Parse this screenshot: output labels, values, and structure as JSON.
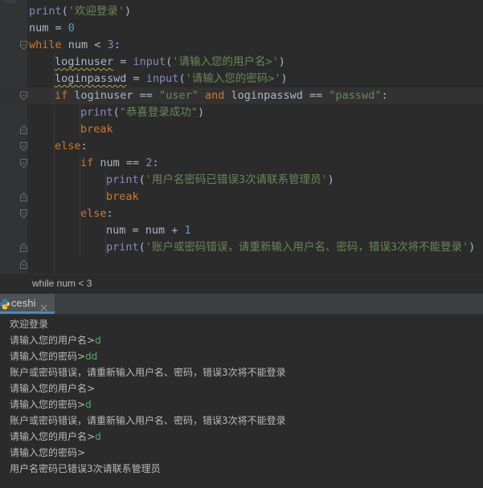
{
  "editor": {
    "lines": [
      [
        {
          "t": "print",
          "c": "fn"
        },
        {
          "t": "(",
          "c": "op"
        },
        {
          "t": "'欢迎登录'",
          "c": "str"
        },
        {
          "t": ")",
          "c": "op"
        }
      ],
      [
        {
          "t": "num",
          "c": "var"
        },
        {
          "t": " = ",
          "c": "op"
        },
        {
          "t": "0",
          "c": "num"
        }
      ],
      [
        {
          "t": "while",
          "c": "kw"
        },
        {
          "t": " num < ",
          "c": "op"
        },
        {
          "t": "3",
          "c": "num"
        },
        {
          "t": ":",
          "c": "op"
        }
      ],
      [
        {
          "t": "loginuser",
          "c": "var warn"
        },
        {
          "t": " = ",
          "c": "op"
        },
        {
          "t": "input",
          "c": "fn"
        },
        {
          "t": "(",
          "c": "op"
        },
        {
          "t": "'请输入您的用户名>'",
          "c": "str"
        },
        {
          "t": ")",
          "c": "op"
        }
      ],
      [
        {
          "t": "loginpasswd",
          "c": "var warn"
        },
        {
          "t": " = ",
          "c": "op"
        },
        {
          "t": "input",
          "c": "fn"
        },
        {
          "t": "(",
          "c": "op"
        },
        {
          "t": "'请输入您的密码>'",
          "c": "str"
        },
        {
          "t": ")",
          "c": "op"
        }
      ],
      [
        {
          "t": "if",
          "c": "kw"
        },
        {
          "t": " loginuser == ",
          "c": "op"
        },
        {
          "t": "\"user\"",
          "c": "str"
        },
        {
          "t": " ",
          "c": "op"
        },
        {
          "t": "and",
          "c": "kw"
        },
        {
          "t": " loginpasswd == ",
          "c": "op"
        },
        {
          "t": "\"passwd\"",
          "c": "str"
        },
        {
          "t": ":",
          "c": "op"
        }
      ],
      [
        {
          "t": "print",
          "c": "fn"
        },
        {
          "t": "(",
          "c": "op"
        },
        {
          "t": "\"恭喜登录成功\"",
          "c": "str"
        },
        {
          "t": ")",
          "c": "op"
        }
      ],
      [
        {
          "t": "break",
          "c": "kw"
        }
      ],
      [
        {
          "t": "else",
          "c": "kw"
        },
        {
          "t": ":",
          "c": "op"
        }
      ],
      [
        {
          "t": "if",
          "c": "kw"
        },
        {
          "t": " num == ",
          "c": "op"
        },
        {
          "t": "2",
          "c": "num"
        },
        {
          "t": ":",
          "c": "op"
        }
      ],
      [
        {
          "t": "print",
          "c": "fn"
        },
        {
          "t": "(",
          "c": "op"
        },
        {
          "t": "'用户名密码已错误3次请联系管理员'",
          "c": "str"
        },
        {
          "t": ")",
          "c": "op"
        }
      ],
      [
        {
          "t": "break",
          "c": "kw"
        }
      ],
      [
        {
          "t": "else",
          "c": "kw"
        },
        {
          "t": ":",
          "c": "op"
        }
      ],
      [
        {
          "t": "num = num + ",
          "c": "op"
        },
        {
          "t": "1",
          "c": "num"
        }
      ],
      [
        {
          "t": "print",
          "c": "fn"
        },
        {
          "t": "(",
          "c": "op"
        },
        {
          "t": "'账户或密码错误，请重新输入用户名、密码，错误3次将不能登录'",
          "c": "str"
        },
        {
          "t": ")",
          "c": "op"
        }
      ],
      []
    ]
  },
  "breadcrumb": "while num < 3",
  "run_tab": {
    "label": "ceshi",
    "icon": "python-icon"
  },
  "console": {
    "lines": [
      [
        {
          "t": "欢迎登录",
          "c": "out"
        }
      ],
      [
        {
          "t": "请输入您的用户名>",
          "c": "out"
        },
        {
          "t": "d",
          "c": "in"
        }
      ],
      [
        {
          "t": "请输入您的密码>",
          "c": "out"
        },
        {
          "t": "dd",
          "c": "in"
        }
      ],
      [
        {
          "t": "账户或密码错误，请重新输入用户名、密码，错误3次将不能登录",
          "c": "out"
        }
      ],
      [
        {
          "t": "请输入您的用户名>",
          "c": "out"
        }
      ],
      [
        {
          "t": "请输入您的密码>",
          "c": "out"
        },
        {
          "t": "d",
          "c": "in"
        }
      ],
      [
        {
          "t": "账户或密码错误，请重新输入用户名、密码，错误3次将不能登录",
          "c": "out"
        }
      ],
      [
        {
          "t": "请输入您的用户名>",
          "c": "out"
        },
        {
          "t": "d",
          "c": "in"
        }
      ],
      [
        {
          "t": "请输入您的密码>",
          "c": "out"
        }
      ],
      [
        {
          "t": "用户名密码已错误3次请联系管理员",
          "c": "out"
        }
      ]
    ]
  },
  "colors": {
    "background": "#2b2b2b",
    "keyword": "#cc7832",
    "string": "#6a8759",
    "number": "#6897bb",
    "builtin": "#8888c6",
    "console_input": "#59a869",
    "tab_accent": "#4a88c7"
  }
}
